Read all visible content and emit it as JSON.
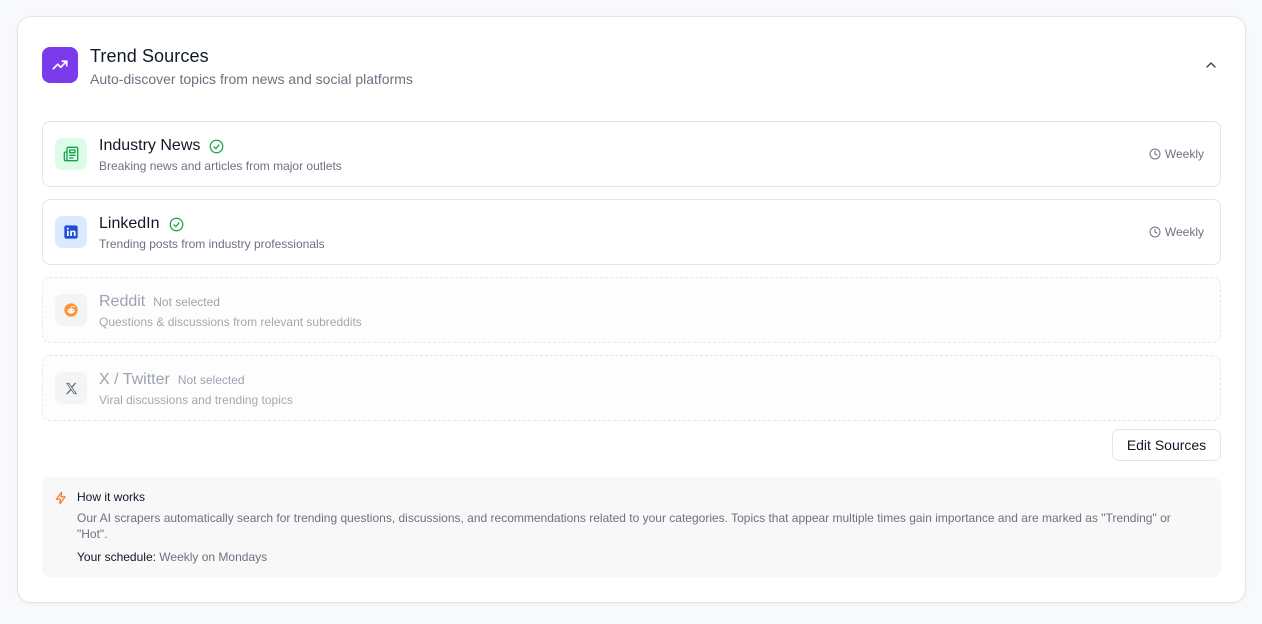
{
  "header": {
    "title": "Trend Sources",
    "subtitle": "Auto-discover topics from news and social platforms",
    "icon": "trending-up-icon",
    "accent_color": "#7c3aed"
  },
  "sources": [
    {
      "name": "Industry News",
      "description": "Breaking news and articles from major outlets",
      "frequency": "Weekly",
      "selected": true,
      "icon": "newspaper-icon",
      "color": "#16a34a"
    },
    {
      "name": "LinkedIn",
      "description": "Trending posts from industry professionals",
      "frequency": "Weekly",
      "selected": true,
      "icon": "linkedin-icon",
      "color": "#1d4ed8"
    },
    {
      "name": "Reddit",
      "description": "Questions & discussions from relevant subreddits",
      "status": "Not selected",
      "selected": false,
      "icon": "reddit-icon",
      "color": "#f97316"
    },
    {
      "name": "X / Twitter",
      "description": "Viral discussions and trending topics",
      "status": "Not selected",
      "selected": false,
      "icon": "x-logo-icon",
      "color": "#6b7280"
    }
  ],
  "edit_button": "Edit Sources",
  "info": {
    "title": "How it works",
    "text": "Our AI scrapers automatically search for trending questions, discussions, and recommendations related to your categories. Topics that appear multiple times gain importance and are marked as \"Trending\" or \"Hot\".",
    "schedule_label": "Your schedule:",
    "schedule_value": "Weekly on Mondays",
    "icon": "lightning-icon",
    "icon_color": "#f97316"
  }
}
